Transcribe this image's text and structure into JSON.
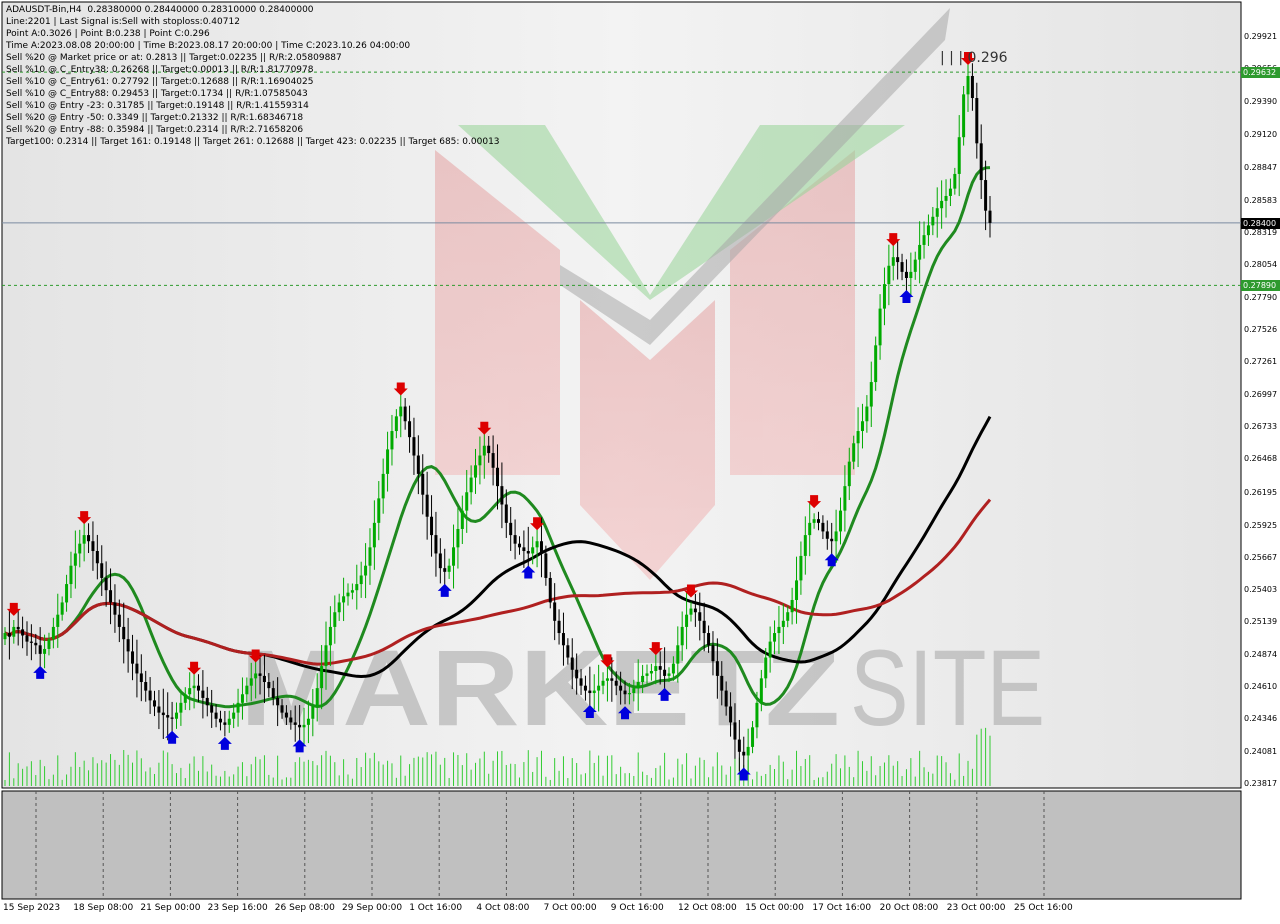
{
  "info_lines": [
    "ADAUSDT-Bin,H4  0.28380000 0.28440000 0.28310000 0.28400000",
    "Line:2201 | Last Signal is:Sell with stoploss:0.40712",
    "Point A:0.3026 | Point B:0.238 | Point C:0.296",
    "Time A:2023.08.08 20:00:00 | Time B:2023.08.17 20:00:00 | Time C:2023.10.26 04:00:00",
    "Sell %20 @ Market price or at: 0.2813 || Target:0.02235 || R/R:2.05809887",
    "Sell %10 @ C_Entry38: 0.26268 || Target:0.00013 || R/R:1.81770978",
    "Sell %10 @ C_Entry61: 0.27792 || Target:0.12688 || R/R:1.16904025",
    "Sell %10 @ C_Entry88: 0.29453 || Target:0.1734 || R/R:1.07585043",
    "Sell %10 @ Entry -23: 0.31785 || Target:0.19148 || R/R:1.41559314",
    "Sell %20 @ Entry -50: 0.3349 || Target:0.21332 || R/R:1.68346718",
    "Sell %20 @ Entry -88: 0.35984 || Target:0.2314 || R/R:2.71658206",
    "Target100: 0.2314 || Target 161: 0.19148 || Target 261: 0.12688 || Target 423: 0.02235 || Target 685: 0.00013"
  ],
  "chart_data": {
    "type": "candlestick",
    "symbol": "ADAUSDT-Bin",
    "timeframe": "H4",
    "ylim": [
      0.23817,
      0.29992
    ],
    "y_ticks": [
      "0.29921",
      "0.29656",
      "0.29390",
      "0.29120",
      "0.28847",
      "0.28583",
      "0.28319",
      "0.28054",
      "0.27790",
      "0.27526",
      "0.27261",
      "0.26997",
      "0.26733",
      "0.26468",
      "0.26195",
      "0.25925",
      "0.25667",
      "0.25403",
      "0.25139",
      "0.24874",
      "0.24610",
      "0.24346",
      "0.24081",
      "0.23817"
    ],
    "x_ticks": [
      "15 Sep 2023",
      "18 Sep 08:00",
      "21 Sep 00:00",
      "23 Sep 16:00",
      "26 Sep 08:00",
      "29 Sep 00:00",
      "1 Oct 16:00",
      "4 Oct 08:00",
      "7 Oct 00:00",
      "9 Oct 16:00",
      "12 Oct 08:00",
      "15 Oct 00:00",
      "17 Oct 16:00",
      "20 Oct 08:00",
      "23 Oct 00:00",
      "25 Oct 16:00"
    ],
    "close_series": [
      0.2505,
      0.2502,
      0.251,
      0.2508,
      0.2503,
      0.2498,
      0.2497,
      0.2495,
      0.2488,
      0.2492,
      0.25,
      0.251,
      0.252,
      0.253,
      0.2545,
      0.256,
      0.257,
      0.2578,
      0.2585,
      0.258,
      0.2572,
      0.2562,
      0.255,
      0.254,
      0.253,
      0.252,
      0.251,
      0.25,
      0.249,
      0.248,
      0.2472,
      0.2465,
      0.2458,
      0.245,
      0.2445,
      0.244,
      0.2438,
      0.2436,
      0.2435,
      0.244,
      0.2448,
      0.2455,
      0.246,
      0.2462,
      0.2458,
      0.2452,
      0.2446,
      0.244,
      0.2435,
      0.2432,
      0.243,
      0.2435,
      0.244,
      0.2448,
      0.2455,
      0.2462,
      0.2468,
      0.2472,
      0.247,
      0.2465,
      0.246,
      0.2452,
      0.2446,
      0.244,
      0.2436,
      0.2432,
      0.243,
      0.2428,
      0.243,
      0.2435,
      0.2445,
      0.246,
      0.2478,
      0.2495,
      0.251,
      0.2522,
      0.253,
      0.2535,
      0.2538,
      0.254,
      0.2545,
      0.2552,
      0.256,
      0.2575,
      0.2595,
      0.2615,
      0.2635,
      0.2655,
      0.267,
      0.2682,
      0.269,
      0.2678,
      0.2665,
      0.265,
      0.2635,
      0.2618,
      0.26,
      0.2585,
      0.257,
      0.2558,
      0.2555,
      0.256,
      0.2575,
      0.259,
      0.2605,
      0.262,
      0.2632,
      0.2642,
      0.265,
      0.2658,
      0.2652,
      0.264,
      0.2625,
      0.261,
      0.2595,
      0.2585,
      0.2578,
      0.2575,
      0.2572,
      0.257,
      0.2575,
      0.258,
      0.257,
      0.255,
      0.253,
      0.2515,
      0.2505,
      0.2495,
      0.2485,
      0.2475,
      0.2468,
      0.2462,
      0.2458,
      0.2456,
      0.2458,
      0.2462,
      0.2466,
      0.2468,
      0.2466,
      0.2462,
      0.2458,
      0.2455,
      0.2456,
      0.246,
      0.2465,
      0.247,
      0.2472,
      0.2474,
      0.2478,
      0.2475,
      0.247,
      0.2472,
      0.248,
      0.2495,
      0.251,
      0.252,
      0.2525,
      0.2522,
      0.2515,
      0.2505,
      0.2495,
      0.2482,
      0.247,
      0.2458,
      0.2445,
      0.2432,
      0.2418,
      0.2408,
      0.2405,
      0.2412,
      0.2428,
      0.2448,
      0.2468,
      0.2485,
      0.2498,
      0.2505,
      0.251,
      0.2515,
      0.2522,
      0.2532,
      0.2548,
      0.2568,
      0.2585,
      0.2595,
      0.2598,
      0.2595,
      0.2588,
      0.2582,
      0.258,
      0.2588,
      0.2605,
      0.2625,
      0.2645,
      0.266,
      0.267,
      0.2678,
      0.269,
      0.271,
      0.274,
      0.277,
      0.279,
      0.2805,
      0.2812,
      0.2808,
      0.28,
      0.2795,
      0.28,
      0.281,
      0.2822,
      0.283,
      0.2838,
      0.2845,
      0.2852,
      0.2858,
      0.2862,
      0.2868,
      0.288,
      0.291,
      0.2945,
      0.296,
      0.2942,
      0.2905,
      0.2875,
      0.285,
      0.284
    ]
  },
  "overlays": {
    "levels": [
      {
        "label": "0.29632",
        "value": 0.29632,
        "color": "#2e9a2e",
        "style": "dashed"
      },
      {
        "label": "0.28400",
        "value": 0.284,
        "color": "#7b8ba0",
        "style": "solid",
        "tag_color": "#000000"
      },
      {
        "label": "0.27890",
        "value": 0.2789,
        "color": "#2e9a2e",
        "style": "dashed"
      }
    ],
    "point_c_label": "| | | 0.296",
    "colors": {
      "bull": "#00aa00",
      "bear": "#000000",
      "buy_arrow": "#0000dd",
      "sell_arrow": "#dd0000",
      "ma_fast": "#1f8a1f",
      "ma_mid": "#000000",
      "ma_slow": "#b02020",
      "volume": "#33cc33"
    }
  },
  "watermark": {
    "text_a": "MARKETZ",
    "text_b": "SITE"
  }
}
